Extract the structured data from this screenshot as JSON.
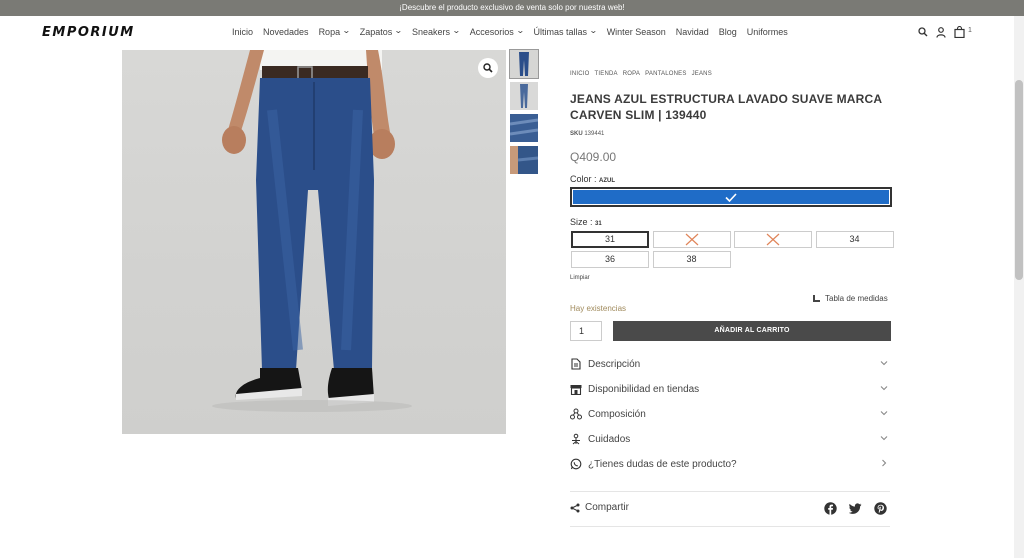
{
  "topbar": {
    "text": "¡Descubre el producto exclusivo de venta solo por nuestra web!"
  },
  "header": {
    "logo": "EMPORIUM",
    "nav": [
      {
        "label": "Inicio",
        "dropdown": false
      },
      {
        "label": "Novedades",
        "dropdown": false
      },
      {
        "label": "Ropa",
        "dropdown": true
      },
      {
        "label": "Zapatos",
        "dropdown": true
      },
      {
        "label": "Sneakers",
        "dropdown": true
      },
      {
        "label": "Accesorios",
        "dropdown": true
      },
      {
        "label": "Últimas tallas",
        "dropdown": true
      },
      {
        "label": "Winter Season",
        "dropdown": false
      },
      {
        "label": "Navidad",
        "dropdown": false
      },
      {
        "label": "Blog",
        "dropdown": false
      },
      {
        "label": "Uniformes",
        "dropdown": false
      }
    ],
    "icons": [
      "search-icon",
      "user-icon",
      "cart-icon"
    ],
    "cart_count": "1"
  },
  "breadcrumb": [
    "INICIO",
    "TIENDA",
    "ROPA",
    "PANTALONES",
    "JEANS"
  ],
  "product": {
    "title": "JEANS AZUL ESTRUCTURA LAVADO SUAVE MARCA CARVEN SLIM | 139440",
    "sku_label": "SKU",
    "sku_value": "139441",
    "price": "Q409.00",
    "color_label": "Color",
    "color_value": "AZUL",
    "color_hex": "#1f6cc7",
    "size_label": "Size",
    "size_value": "31",
    "sizes": [
      {
        "label": "31",
        "selected": true,
        "available": true
      },
      {
        "label": "",
        "selected": false,
        "available": false
      },
      {
        "label": "",
        "selected": false,
        "available": false
      },
      {
        "label": "34",
        "selected": false,
        "available": true
      },
      {
        "label": "36",
        "selected": false,
        "available": true
      },
      {
        "label": "38",
        "selected": false,
        "available": true
      }
    ],
    "clear_label": "Limpiar",
    "size_chart_label": "Tabla de medidas",
    "stock_label": "Hay existencias",
    "quantity": "1",
    "add_to_cart_label": "AÑADIR AL CARRITO"
  },
  "accordion": [
    {
      "label": "Descripción",
      "icon": "document-icon"
    },
    {
      "label": "Disponibilidad en tiendas",
      "icon": "store-icon"
    },
    {
      "label": "Composición",
      "icon": "molecule-icon"
    },
    {
      "label": "Cuidados",
      "icon": "care-icon"
    },
    {
      "label": "¿Tienes dudas de este producto?",
      "icon": "whatsapp-icon"
    }
  ],
  "share": {
    "label": "Compartir",
    "networks": [
      "facebook-icon",
      "twitter-icon",
      "pinterest-icon"
    ]
  },
  "colors": {
    "accent": "#1f6cc7",
    "button_bg": "#4a4a4a",
    "topbar_bg": "#7a7a75",
    "stock_text": "#a08a5c"
  }
}
